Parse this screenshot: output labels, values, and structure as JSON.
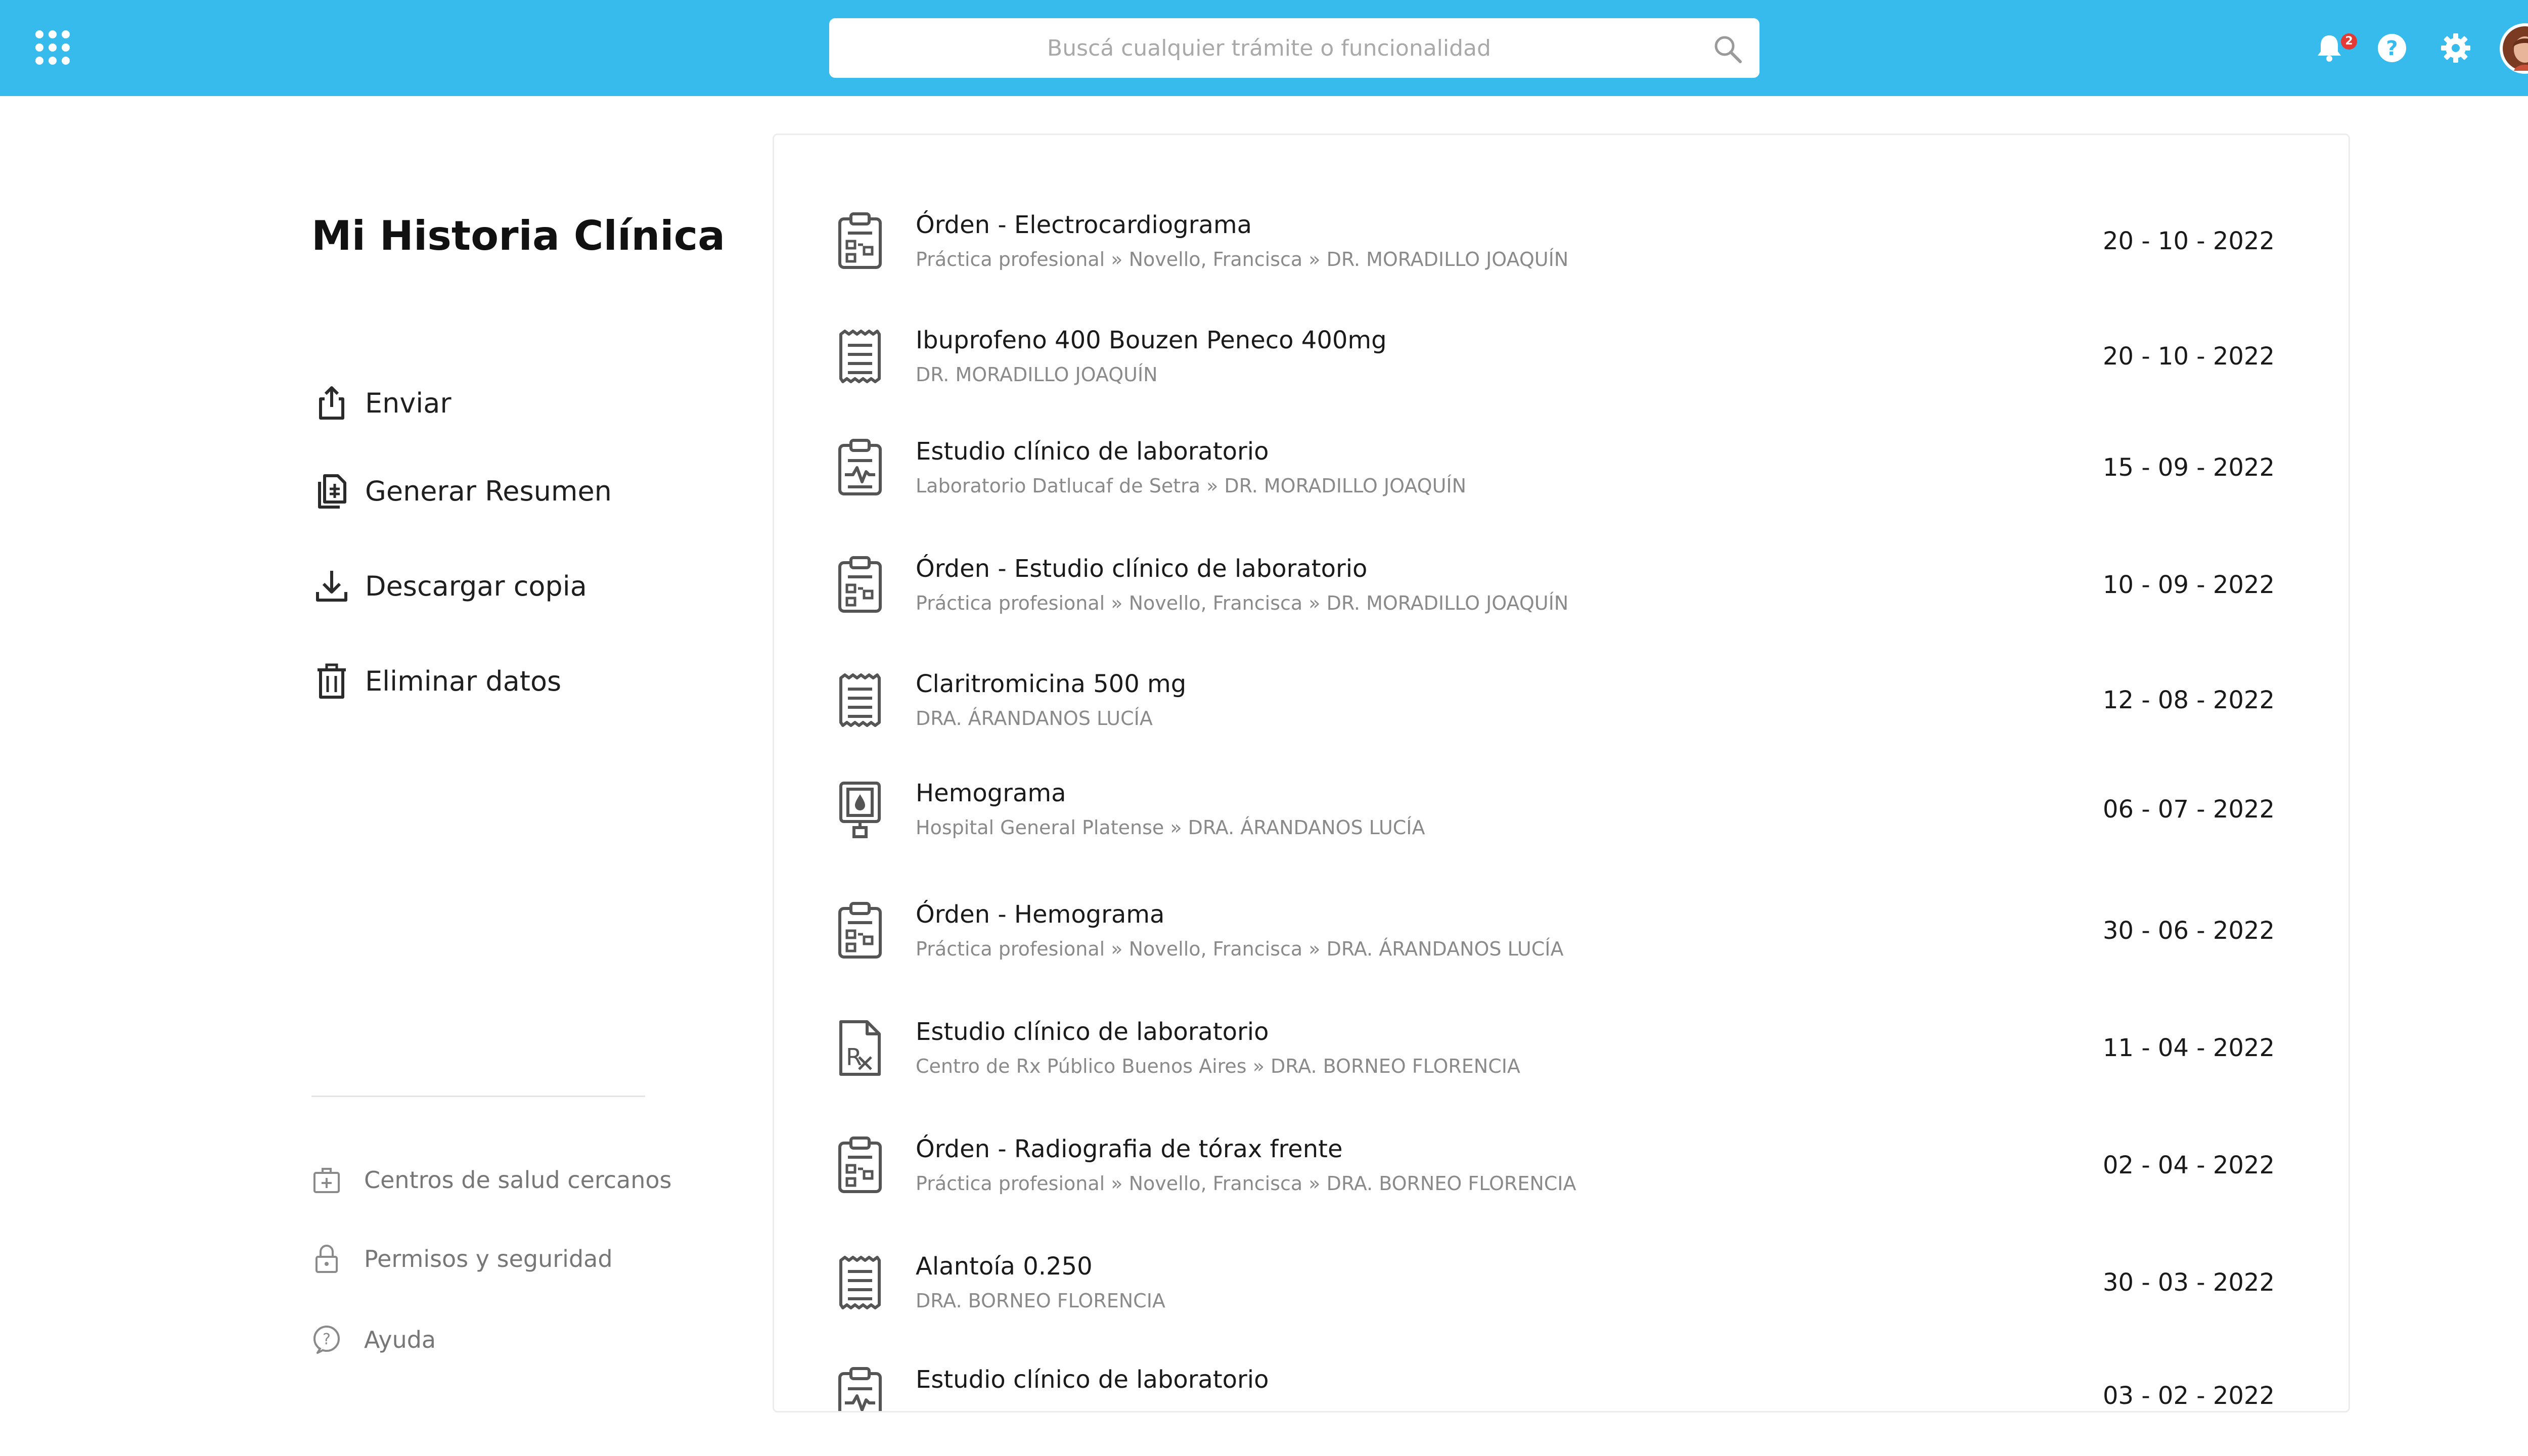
{
  "topbar": {
    "search_placeholder": "Buscá cualquier trámite o funcionalidad",
    "notification_count": "2",
    "apps_icon": "grid-icon",
    "icons": [
      "bell-icon",
      "help-icon",
      "gear-icon",
      "avatar"
    ]
  },
  "sidebar": {
    "title": "Mi Historia Clínica",
    "actions": [
      {
        "label": "Enviar",
        "icon": "share-upload-icon"
      },
      {
        "label": "Generar Resumen",
        "icon": "document-summary-icon"
      },
      {
        "label": "Descargar copia",
        "icon": "download-icon"
      },
      {
        "label": "Eliminar datos",
        "icon": "trash-icon"
      }
    ],
    "footer_links": [
      {
        "label": "Centros de salud cercanos",
        "icon": "medical-bag-icon"
      },
      {
        "label": "Permisos y seguridad",
        "icon": "lock-icon"
      },
      {
        "label": "Ayuda",
        "icon": "help-circle-icon"
      }
    ]
  },
  "records": [
    {
      "icon": "clipboard-order-icon",
      "title": "Órden - Electrocardiograma",
      "subtitle": "Práctica profesional » Novello, Francisca » DR. MORADILLO JOAQUÍN",
      "date": "20 - 10 - 2022"
    },
    {
      "icon": "prescription-list-icon",
      "title": "Ibuprofeno 400 Bouzen Peneco 400mg",
      "subtitle": "DR. MORADILLO JOAQUÍN",
      "date": "20 - 10 - 2022"
    },
    {
      "icon": "clipboard-pulse-icon",
      "title": "Estudio clínico de laboratorio",
      "subtitle": "Laboratorio Datlucaf de Setra » DR. MORADILLO JOAQUÍN",
      "date": "15 - 09 - 2022"
    },
    {
      "icon": "clipboard-order-icon",
      "title": "Órden - Estudio clínico de laboratorio",
      "subtitle": "Práctica profesional » Novello, Francisca » DR. MORADILLO JOAQUÍN",
      "date": "10 - 09 - 2022"
    },
    {
      "icon": "prescription-list-icon",
      "title": "Claritromicina 500 mg",
      "subtitle": "DRA. ÁRANDANOS LUCÍA",
      "date": "12 - 08 - 2022"
    },
    {
      "icon": "blood-test-icon",
      "title": "Hemograma",
      "subtitle": "Hospital General Platense » DRA. ÁRANDANOS LUCÍA",
      "date": "06 - 07 - 2022"
    },
    {
      "icon": "clipboard-order-icon",
      "title": "Órden - Hemograma",
      "subtitle": "Práctica profesional » Novello, Francisca » DRA. ÁRANDANOS LUCÍA",
      "date": "30 - 06 - 2022"
    },
    {
      "icon": "rx-document-icon",
      "title": "Estudio clínico de laboratorio",
      "subtitle": "Centro de Rx Público Buenos Aires » DRA. BORNEO FLORENCIA",
      "date": "11 - 04 - 2022"
    },
    {
      "icon": "clipboard-order-icon",
      "title": "Órden - Radiografia de tórax frente",
      "subtitle": "Práctica profesional » Novello, Francisca » DRA. BORNEO FLORENCIA",
      "date": "02 - 04 - 2022"
    },
    {
      "icon": "prescription-list-icon",
      "title": "Alantoía 0.250",
      "subtitle": "DRA. BORNEO FLORENCIA",
      "date": "30 - 03 - 2022"
    },
    {
      "icon": "clipboard-pulse-icon",
      "title": "Estudio clínico de laboratorio",
      "subtitle": "",
      "date": "03 - 02 - 2022"
    }
  ]
}
